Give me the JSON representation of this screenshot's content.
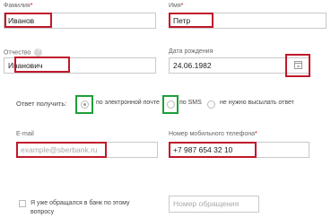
{
  "form": {
    "surname": {
      "label": "Фамилия",
      "required_mark": "*",
      "value": "Иванов"
    },
    "name": {
      "label": "Имя",
      "required_mark": "*",
      "value": "Петр"
    },
    "patronymic": {
      "label": "Отчество",
      "value": "Иванович"
    },
    "birth_date": {
      "label": "Дата рождения",
      "value": "24.06.1982"
    },
    "receive_answer": {
      "label": "Ответ получить:",
      "options": [
        {
          "label": "по электронной почте",
          "selected": true
        },
        {
          "label": "по SMS",
          "selected": false
        },
        {
          "label": "не нужно высылать ответ",
          "selected": false
        }
      ]
    },
    "email": {
      "label": "E-mail",
      "placeholder": "example@sberbank.ru"
    },
    "mobile": {
      "label": "Номер мобильного телефона",
      "required_mark": "*",
      "value": "+7 987 654 32 10"
    },
    "already_contacted": {
      "label_line1": "Я уже обращался в банк по этому",
      "label_line2": "вопросу",
      "checked": false
    },
    "request_number": {
      "placeholder": "Номер обращения"
    }
  },
  "help_glyph": "?",
  "colors": {
    "highlight_red": "#c0182b",
    "highlight_green": "#1f9e3a"
  }
}
